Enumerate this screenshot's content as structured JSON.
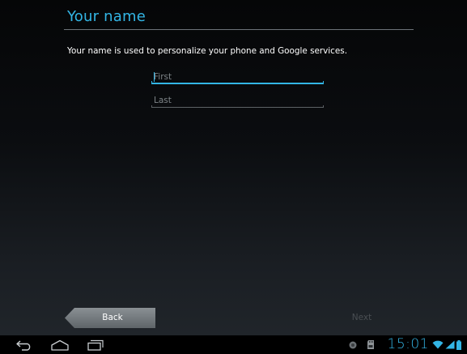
{
  "setup": {
    "title": "Your name",
    "description": "Your name is used to personalize your phone and Google services."
  },
  "form": {
    "first": {
      "placeholder": "First",
      "value": "",
      "focused": true
    },
    "last": {
      "placeholder": "Last",
      "value": ""
    }
  },
  "buttons": {
    "back_label": "Back",
    "next_label": "Next",
    "next_enabled": false
  },
  "navbar": {
    "icons": [
      "back-icon",
      "home-icon",
      "recent-apps-icon"
    ]
  },
  "status_bar": {
    "clock": "15:01",
    "icons": [
      "sync-icon",
      "sd-card-icon",
      "wifi-icon",
      "signal-icon",
      "battery-icon"
    ]
  },
  "colors": {
    "accent": "#33b5e5",
    "background": "#0b0d10",
    "disabled_text": "#4a4f53"
  }
}
